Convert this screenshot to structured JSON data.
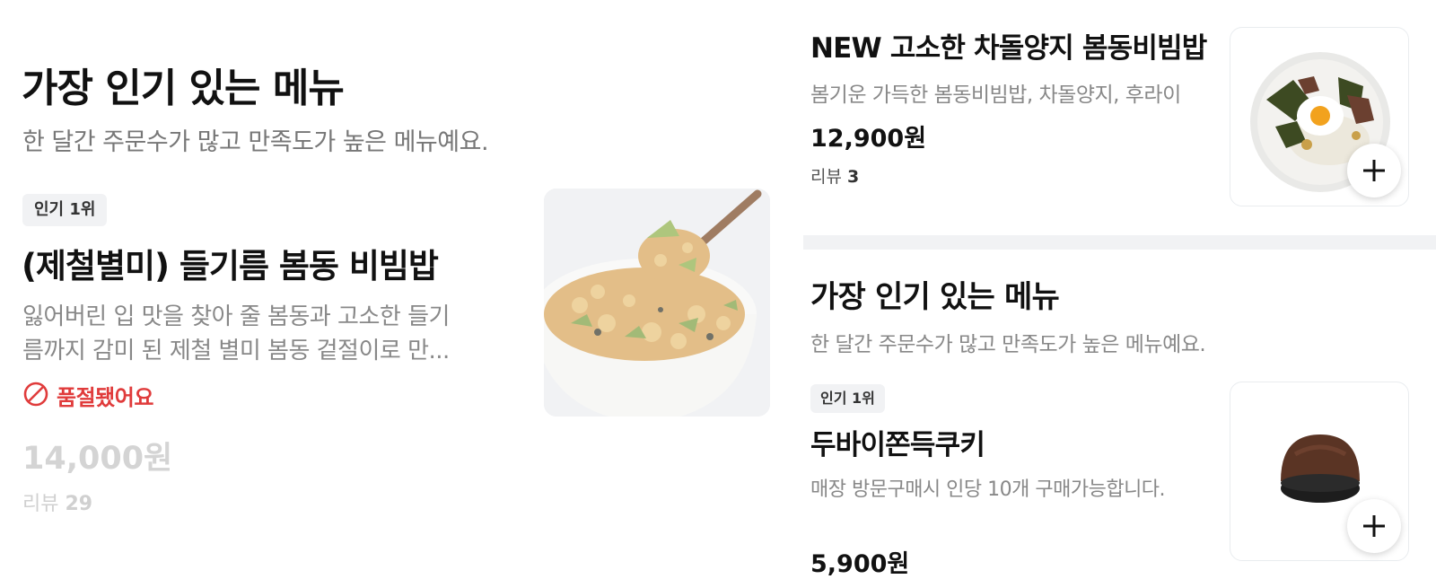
{
  "popular_section": {
    "title": "가장 인기 있는 메뉴",
    "subtitle": "한 달간 주문수가 많고 만족도가 높은 메뉴예요."
  },
  "featured_item": {
    "badge": "인기 1위",
    "name": "(제철별미) 들기름 봄동 비빔밥",
    "description_line1": "잃어버린 입 맛을 찾아 줄 봄동과 고소한 들기",
    "description_line2": "름까지 감미 된 제철 별미 봄동 겉절이로 만...",
    "status": "품절됐어요",
    "price": "14,000원",
    "review_label": "리뷰",
    "review_count": "29",
    "image_icon": "bibimbap-bowl-photo"
  },
  "right_item_1": {
    "name": "NEW 고소한 차돌양지 봄동비빔밥",
    "description": "봄기운 가득한 봄동비빔밥, 차돌양지, 후라이",
    "price": "12,900원",
    "review_label": "리뷰",
    "review_count": "3",
    "image_icon": "bibimbap-plate-photo"
  },
  "right_section": {
    "title": "가장 인기 있는 메뉴",
    "subtitle": "한 달간 주문수가 많고 만족도가 높은 메뉴예요."
  },
  "right_item_2": {
    "badge": "인기 1위",
    "name": "두바이쫀득쿠키",
    "description": "매장 방문구매시 인당 10개 구매가능합니다.",
    "price": "5,900원",
    "image_icon": "cookie-photo"
  },
  "colors": {
    "soldout_red": "#e03b3b",
    "badge_bg": "#f1f2f4",
    "muted_text": "#888888",
    "disabled_text": "#d4d4d4"
  }
}
